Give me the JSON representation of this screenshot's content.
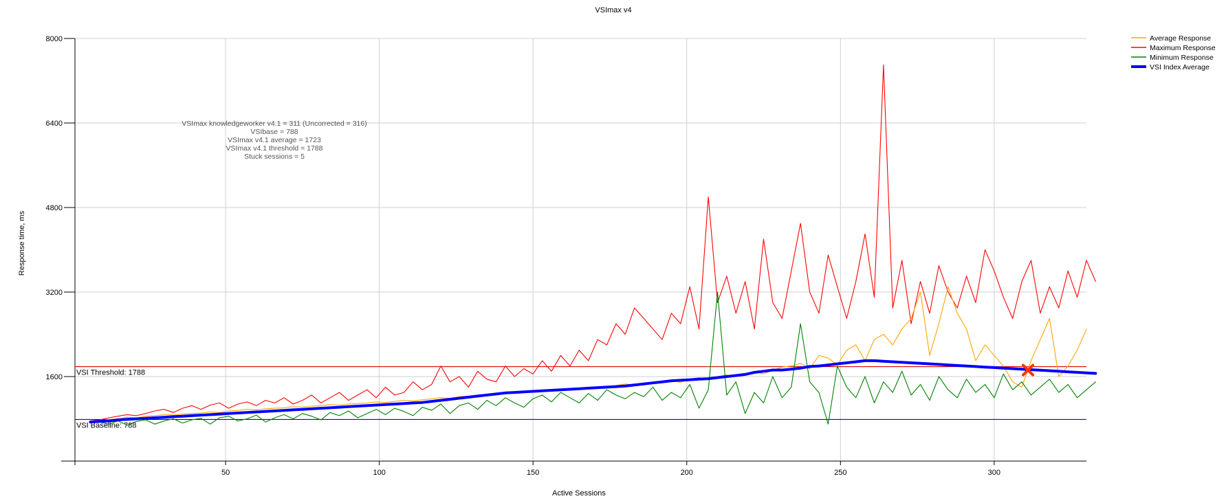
{
  "chart_data": {
    "type": "line",
    "title": "VSImax v4",
    "xlabel": "Active Sessions",
    "ylabel": "Response time, ms",
    "xlim": [
      1,
      330
    ],
    "ylim": [
      0,
      8000
    ],
    "x_ticks": [
      50,
      100,
      150,
      200,
      250,
      300
    ],
    "y_ticks": [
      1600,
      3200,
      4800,
      6400,
      8000
    ],
    "grid": true,
    "legend_position": "top-right",
    "legend": [
      {
        "name": "Average Response",
        "color": "#ffa500"
      },
      {
        "name": "Maximum Response",
        "color": "#ff0000"
      },
      {
        "name": "Minimum Response",
        "color": "#008000"
      },
      {
        "name": "VSI Index Average",
        "color": "#0000ff"
      }
    ],
    "reference_lines": [
      {
        "label": "VSI Threshold: 1788",
        "value": 1788,
        "color": "#e00000"
      },
      {
        "label": "VSI Baseline: 788",
        "value": 788,
        "color": "#0000ff"
      }
    ],
    "annotations": [
      "VSImax knowledgeworker v4.1 = 311 (Uncorrected = 316)",
      "VSIbase = 788",
      "VSImax v4.1 average = 1723",
      "VSImax v4.1 threshold = 1788",
      "Stuck sessions = 5"
    ],
    "vsimax_marker": {
      "x": 311,
      "y": 1723,
      "color": "#ff3300"
    },
    "x_start": 6,
    "x_step": 3,
    "series": [
      {
        "name": "Average Response",
        "color": "#ffa500",
        "values": [
          740,
          760,
          790,
          800,
          830,
          820,
          850,
          860,
          880,
          870,
          890,
          900,
          910,
          930,
          920,
          950,
          960,
          980,
          970,
          990,
          1000,
          1010,
          1030,
          1020,
          1040,
          1050,
          1070,
          1060,
          1080,
          1090,
          1100,
          1120,
          1110,
          1130,
          1150,
          1140,
          1160,
          1180,
          1200,
          1190,
          1220,
          1230,
          1250,
          1240,
          1260,
          1280,
          1290,
          1310,
          1330,
          1320,
          1340,
          1360,
          1350,
          1380,
          1400,
          1390,
          1410,
          1430,
          1460,
          1440,
          1470,
          1490,
          1500,
          1520,
          1490,
          1550,
          1580,
          1540,
          1600,
          1630,
          1600,
          1660,
          1700,
          1650,
          1720,
          1780,
          1800,
          1850,
          1750,
          2000,
          1950,
          1820,
          2100,
          2200,
          1900,
          2300,
          2400,
          2200,
          2500,
          2700,
          3200,
          2000,
          2600,
          3300,
          2800,
          2500,
          1900,
          2200,
          2000,
          1800,
          1500,
          1400,
          1900,
          2300,
          2700,
          1600,
          1800,
          2100,
          2500
        ]
      },
      {
        "name": "Maximum Response",
        "color": "#ff0000",
        "values": [
          760,
          780,
          820,
          850,
          880,
          860,
          900,
          950,
          980,
          920,
          1000,
          1050,
          980,
          1060,
          1100,
          1000,
          1080,
          1120,
          1050,
          1150,
          1100,
          1200,
          1080,
          1150,
          1250,
          1100,
          1200,
          1300,
          1150,
          1250,
          1350,
          1200,
          1400,
          1250,
          1300,
          1500,
          1350,
          1450,
          1800,
          1500,
          1600,
          1400,
          1700,
          1550,
          1500,
          1800,
          1600,
          1750,
          1650,
          1900,
          1700,
          2000,
          1800,
          2100,
          1900,
          2300,
          2200,
          2600,
          2400,
          2900,
          2700,
          2500,
          2300,
          2800,
          2600,
          3300,
          2500,
          5000,
          3000,
          3500,
          2800,
          3400,
          2500,
          4200,
          3000,
          2700,
          3600,
          4500,
          3200,
          2800,
          3900,
          3300,
          2700,
          3400,
          4300,
          3100,
          7500,
          2900,
          3800,
          2600,
          3400,
          2800,
          3700,
          3200,
          2900,
          3500,
          3000,
          4000,
          3600,
          3100,
          2700,
          3400,
          3800,
          2800,
          3300,
          2900,
          3600,
          3100,
          3800,
          3400
        ]
      },
      {
        "name": "Minimum Response",
        "color": "#008000",
        "values": [
          720,
          740,
          700,
          760,
          680,
          750,
          780,
          700,
          760,
          800,
          720,
          780,
          810,
          700,
          820,
          850,
          760,
          800,
          870,
          740,
          820,
          880,
          800,
          900,
          850,
          780,
          920,
          860,
          950,
          820,
          900,
          980,
          880,
          1000,
          940,
          860,
          1020,
          960,
          1080,
          900,
          1050,
          1100,
          980,
          1150,
          1050,
          1200,
          1100,
          1020,
          1180,
          1250,
          1120,
          1300,
          1200,
          1100,
          1280,
          1150,
          1350,
          1250,
          1180,
          1300,
          1220,
          1400,
          1150,
          1300,
          1200,
          1450,
          1000,
          1350,
          3200,
          1250,
          1500,
          900,
          1300,
          1100,
          1600,
          1200,
          1400,
          2600,
          1500,
          1300,
          700,
          1800,
          1400,
          1200,
          1600,
          1100,
          1500,
          1300,
          1700,
          1250,
          1450,
          1150,
          1600,
          1350,
          1200,
          1550,
          1300,
          1450,
          1200,
          1650,
          1350,
          1500,
          1250,
          1400,
          1550,
          1300,
          1450,
          1200,
          1350,
          1500
        ]
      },
      {
        "name": "VSI Index Average",
        "color": "#0000ff",
        "values": [
          740,
          750,
          760,
          780,
          790,
          800,
          810,
          820,
          830,
          840,
          850,
          860,
          870,
          880,
          890,
          900,
          910,
          920,
          930,
          940,
          950,
          960,
          970,
          980,
          990,
          1000,
          1010,
          1020,
          1030,
          1040,
          1050,
          1060,
          1070,
          1080,
          1090,
          1100,
          1110,
          1130,
          1150,
          1170,
          1190,
          1210,
          1230,
          1250,
          1270,
          1290,
          1300,
          1310,
          1320,
          1330,
          1340,
          1350,
          1360,
          1370,
          1380,
          1390,
          1400,
          1410,
          1420,
          1440,
          1460,
          1480,
          1500,
          1520,
          1530,
          1540,
          1550,
          1560,
          1580,
          1600,
          1620,
          1640,
          1680,
          1700,
          1723,
          1723,
          1740,
          1760,
          1790,
          1800,
          1820,
          1840,
          1860,
          1880,
          1900,
          1900,
          1890,
          1880,
          1870,
          1860,
          1850,
          1840,
          1830,
          1820,
          1810,
          1800,
          1790,
          1780,
          1770,
          1760,
          1750,
          1740,
          1730,
          1720,
          1710,
          1700,
          1690,
          1680,
          1670,
          1660
        ]
      }
    ]
  }
}
